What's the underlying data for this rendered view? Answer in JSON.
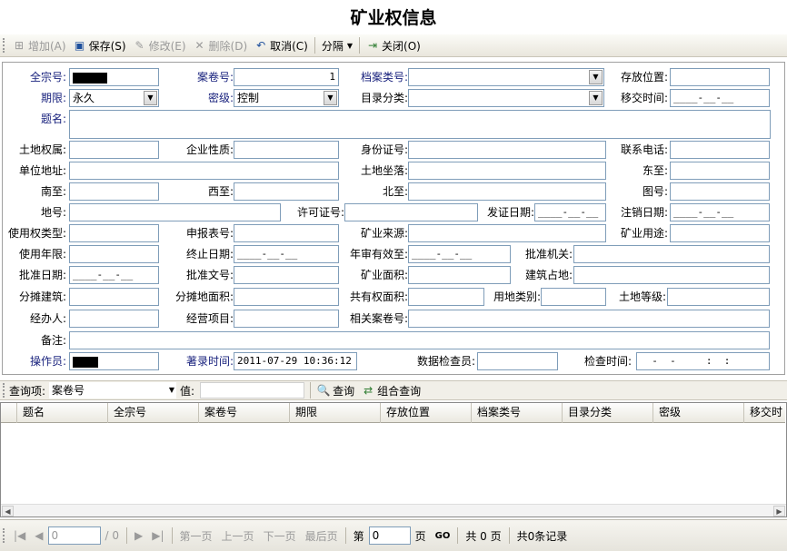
{
  "window": {
    "title": "矿业权信息"
  },
  "toolbar": {
    "add": "增加(A)",
    "save": "保存(S)",
    "edit": "修改(E)",
    "delete": "删除(D)",
    "cancel": "取消(C)",
    "split": "分隔",
    "close": "关闭(O)"
  },
  "form": {
    "quanzong": {
      "label": "全宗号:",
      "value": ""
    },
    "anjuan": {
      "label": "案卷号:",
      "value": "1"
    },
    "dangan_type": {
      "label": "档案类号:",
      "value": ""
    },
    "storage": {
      "label": "存放位置:",
      "value": ""
    },
    "period": {
      "label": "期限:",
      "value": "永久"
    },
    "secret": {
      "label": "密级:",
      "value": "控制"
    },
    "catalog": {
      "label": "目录分类:",
      "value": ""
    },
    "transfer_time": {
      "label": "移交时间:",
      "value": "____-__-__"
    },
    "title": {
      "label": "题名:",
      "value": ""
    },
    "land_owner": {
      "label": "土地权属:",
      "value": ""
    },
    "company_type": {
      "label": "企业性质:",
      "value": ""
    },
    "id_number": {
      "label": "身份证号:",
      "value": ""
    },
    "phone": {
      "label": "联系电话:",
      "value": ""
    },
    "address": {
      "label": "单位地址:",
      "value": ""
    },
    "land_location": {
      "label": "土地坐落:",
      "value": ""
    },
    "east": {
      "label": "东至:",
      "value": ""
    },
    "south": {
      "label": "南至:",
      "value": ""
    },
    "west": {
      "label": "西至:",
      "value": ""
    },
    "north": {
      "label": "北至:",
      "value": ""
    },
    "map_no": {
      "label": "图号:",
      "value": ""
    },
    "land_no": {
      "label": "地号:",
      "value": ""
    },
    "license_no": {
      "label": "许可证号:",
      "value": ""
    },
    "issue_date": {
      "label": "发证日期:",
      "value": "____-__-__"
    },
    "cancel_date": {
      "label": "注销日期:",
      "value": "____-__-__"
    },
    "use_type": {
      "label": "使用权类型:",
      "value": ""
    },
    "apply_no": {
      "label": "申报表号:",
      "value": ""
    },
    "mine_source": {
      "label": "矿业来源:",
      "value": ""
    },
    "mine_use": {
      "label": "矿业用途:",
      "value": ""
    },
    "use_years": {
      "label": "使用年限:",
      "value": ""
    },
    "end_date": {
      "label": "终止日期:",
      "value": "____-__-__"
    },
    "audit_valid": {
      "label": "年审有效至:",
      "value": "____-__-__"
    },
    "approve_org": {
      "label": "批准机关:",
      "value": ""
    },
    "approve_date": {
      "label": "批准日期:",
      "value": "____-__-__"
    },
    "approve_doc": {
      "label": "批准文号:",
      "value": ""
    },
    "mine_area": {
      "label": "矿业面积:",
      "value": ""
    },
    "building_area": {
      "label": "建筑占地:",
      "value": ""
    },
    "shared_building": {
      "label": "分摊建筑:",
      "value": ""
    },
    "shared_land": {
      "label": "分摊地面积:",
      "value": ""
    },
    "common_area": {
      "label": "共有权面积:",
      "value": ""
    },
    "land_category": {
      "label": "用地类别:",
      "value": ""
    },
    "land_grade": {
      "label": "土地等级:",
      "value": ""
    },
    "handler": {
      "label": "经办人:",
      "value": ""
    },
    "business": {
      "label": "经营项目:",
      "value": ""
    },
    "related_no": {
      "label": "相关案卷号:",
      "value": ""
    },
    "remark": {
      "label": "备注:",
      "value": ""
    },
    "operator": {
      "label": "操作员:",
      "value": ""
    },
    "record_time": {
      "label": "著录时间:",
      "value": "2011-07-29 10:36:12"
    },
    "checker": {
      "label": "数据检查员:",
      "value": ""
    },
    "check_time": {
      "label": "检查时间:",
      "value": "  -  -     :  :"
    }
  },
  "query": {
    "item_label": "查询项:",
    "item_value": "案卷号",
    "value_label": "值:",
    "value": "",
    "search": "查询",
    "combo_search": "组合查询"
  },
  "grid": {
    "columns": [
      "题名",
      "全宗号",
      "案卷号",
      "期限",
      "存放位置",
      "档案类号",
      "目录分类",
      "密级",
      "移交时"
    ]
  },
  "pager": {
    "current_input": "0",
    "total_display": "/ 0",
    "first": "第一页",
    "prev": "上一页",
    "next": "下一页",
    "last": "最后页",
    "page_prefix": "第",
    "page_input": "0",
    "page_suffix": "页",
    "go": "GO",
    "total_pages": "共 0 页",
    "total_records": "共0条记录"
  }
}
